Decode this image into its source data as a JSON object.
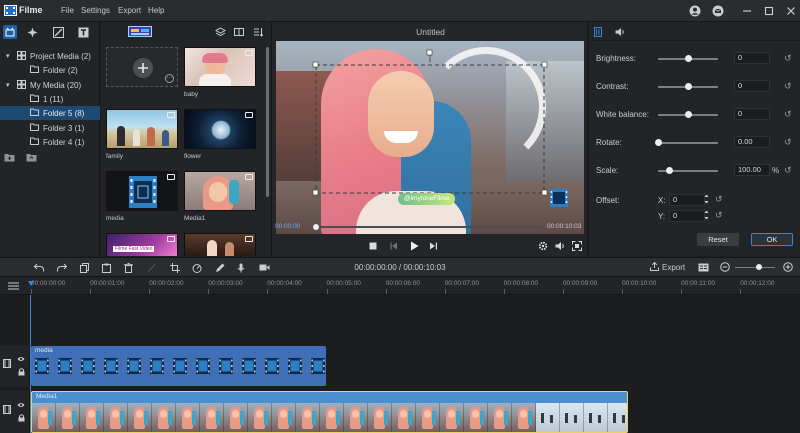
{
  "app": {
    "name": "Filme",
    "menu": [
      "File",
      "Settings",
      "Export",
      "Help"
    ]
  },
  "window_icons": [
    "account-icon",
    "mail-icon",
    "minimize-icon",
    "maximize-icon",
    "close-icon"
  ],
  "media_tree": [
    {
      "label": "Project Media (2)",
      "level": 0,
      "expanded": true
    },
    {
      "label": "Folder (2)",
      "level": 1
    },
    {
      "label": "My Media (20)",
      "level": 0,
      "expanded": true
    },
    {
      "label": "1 (11)",
      "level": 1
    },
    {
      "label": "Folder 5 (8)",
      "level": 1,
      "selected": true
    },
    {
      "label": "Folder 3 (1)",
      "level": 1
    },
    {
      "label": "Folder 4 (1)",
      "level": 1
    }
  ],
  "media_items": [
    {
      "name": "",
      "kind": "add"
    },
    {
      "name": "baby",
      "kind": "image"
    },
    {
      "name": "family",
      "kind": "image"
    },
    {
      "name": "flower",
      "kind": "image"
    },
    {
      "name": "media",
      "kind": "video"
    },
    {
      "name": "Media1",
      "kind": "video"
    },
    {
      "name": "",
      "kind": "video",
      "overlay": "Filme Fast Video"
    },
    {
      "name": "",
      "kind": "video"
    }
  ],
  "preview": {
    "title": "Untitled",
    "watermark": "@imyfoneFilme",
    "current_time": "00:00:00",
    "total_time": "00:00:10:03",
    "progress": 0.0
  },
  "properties": {
    "tabs": [
      "video-tab-icon",
      "audio-tab-icon"
    ],
    "sliders": [
      {
        "label": "Brightness:",
        "value": "0",
        "level": 0.5
      },
      {
        "label": "Contrast:",
        "value": "0",
        "level": 0.5
      },
      {
        "label": "White balance:",
        "value": "0",
        "level": 0.5
      },
      {
        "label": "Rotate:",
        "value": "0.00",
        "level": 0.0
      },
      {
        "label": "Scale:",
        "value": "100.00",
        "unit": "%",
        "level": 0.18
      }
    ],
    "offset": {
      "label": "Offset:",
      "x_label": "X:",
      "x_value": "0",
      "y_label": "Y:",
      "y_value": "0"
    },
    "reset_label": "Reset",
    "ok_label": "OK"
  },
  "timeline": {
    "timecode": "00:00:00:00 / 00:00:10:03",
    "export_label": "Export",
    "zoom_level": 0.6,
    "ruler": [
      "00:00:00:00",
      "00:00:01:00",
      "00:00:02:00",
      "00:00:03:00",
      "00:00:04:00",
      "00:00:05:00",
      "00:00:06:00",
      "00:00:07:00",
      "00:00:08:00",
      "00:00:09:00",
      "00:00:10:00",
      "00:00:11:00",
      "00:00:12:00"
    ],
    "tracks": [
      {
        "clip": "media",
        "color": "#3f6fb6"
      },
      {
        "clip": "Media1",
        "color": "#4a8fd0"
      }
    ]
  },
  "colors": {
    "accent": "#3a86d6",
    "selected": "#1d4a73",
    "video_clip": "#3f6fb6",
    "image_clip": "#4a8fd0"
  }
}
